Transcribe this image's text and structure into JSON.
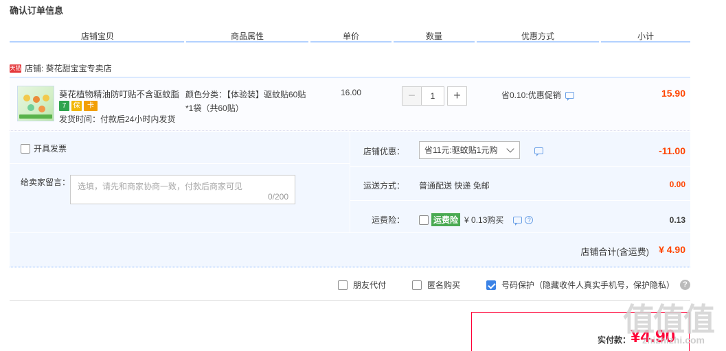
{
  "page_title": "确认订单信息",
  "columns": [
    "店铺宝贝",
    "商品属性",
    "单价",
    "数量",
    "优惠方式",
    "小计"
  ],
  "shop": {
    "badge": "天猫",
    "label": "店铺: 葵花甜宝宝专卖店"
  },
  "item": {
    "name": "葵花植物精油防叮贴不含驱蚊脂",
    "service_icons": [
      "7",
      "保",
      "卡"
    ],
    "ship_time": "发货时间：付款后24小时内发货",
    "attrs": "颜色分类：【体验装】驱蚊贴60贴*1袋（共60贴）",
    "unit_price": "16.00",
    "qty_minus": "−",
    "qty": "1",
    "qty_plus": "+",
    "promo": "省0.10:优惠促销",
    "subtotal": "15.90"
  },
  "options": {
    "invoice": "开具发票",
    "message_label": "给卖家留言：",
    "message_placeholder": "选填，请先和商家协商一致，付款后商家可见",
    "message_count": "0/200",
    "coupon_label": "店铺优惠：",
    "coupon_value": "省11元:驱蚊贴1元购",
    "coupon_amount": "-11.00",
    "ship_label": "运送方式：",
    "ship_method": "普通配送 快递 免邮",
    "ship_amount": "0.00",
    "ins_label": "运费险：",
    "ins_tag": "运费险",
    "ins_price": "¥ 0.13购买",
    "ins_help": "?",
    "ins_amount": "0.13"
  },
  "total": {
    "label": "店铺合计(含运费)",
    "value": "¥ 4.90"
  },
  "extras": {
    "friend_pay": "朋友代付",
    "anonymous": "匿名购买",
    "number_protect": "号码保护（隐藏收件人真实手机号，保护隐私）",
    "help": "?"
  },
  "payment": {
    "label": "实付款：",
    "value": "¥4.90"
  },
  "watermark": {
    "chars": "值值值",
    "url": "zhizhizhi.com"
  },
  "colors": {
    "accent": "#ff4400",
    "pay_red": "#ff0036",
    "header_line": "#b2d1ff",
    "option_bg": "#f2f7ff",
    "checkbox_blue": "#3b83e6",
    "ins_green": "#4aaa52"
  },
  "icons": [
    "tmall-badge",
    "chat-icon",
    "help-icon",
    "caret-down-icon",
    "question-icon"
  ]
}
